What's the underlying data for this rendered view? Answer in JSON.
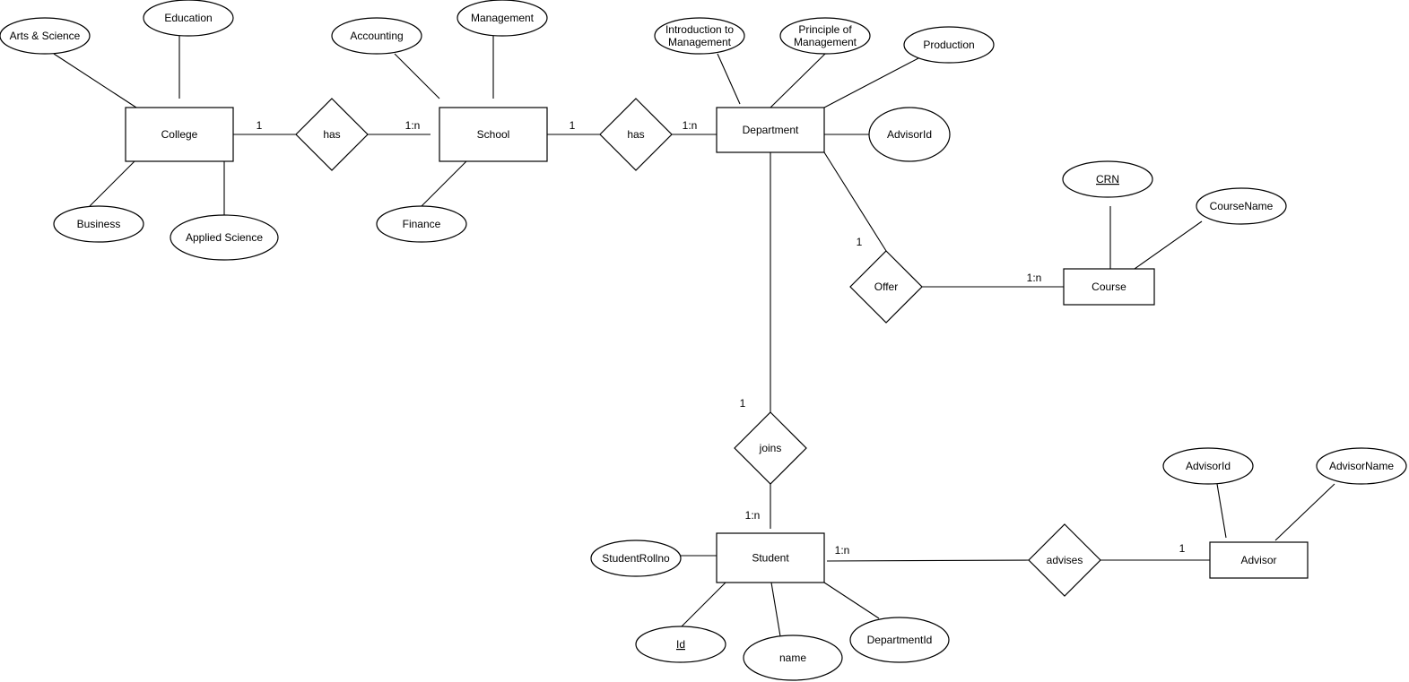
{
  "diagram": {
    "type": "entity-relationship",
    "entities": [
      {
        "id": "college",
        "label": "College"
      },
      {
        "id": "school",
        "label": "School"
      },
      {
        "id": "department",
        "label": "Department"
      },
      {
        "id": "course",
        "label": "Course"
      },
      {
        "id": "student",
        "label": "Student"
      },
      {
        "id": "advisor",
        "label": "Advisor"
      }
    ],
    "relationships": [
      {
        "id": "has1",
        "label": "has"
      },
      {
        "id": "has2",
        "label": "has"
      },
      {
        "id": "offer",
        "label": "Offer"
      },
      {
        "id": "joins",
        "label": "joins"
      },
      {
        "id": "advises",
        "label": "advises"
      }
    ],
    "attributes": [
      {
        "id": "a_arts",
        "label": "Arts & Science",
        "entity": "college"
      },
      {
        "id": "a_edu",
        "label": "Education",
        "entity": "college"
      },
      {
        "id": "a_bus",
        "label": "Business",
        "entity": "college"
      },
      {
        "id": "a_appsci",
        "label": "Applied Science",
        "entity": "college"
      },
      {
        "id": "a_acct",
        "label": "Accounting",
        "entity": "school"
      },
      {
        "id": "a_mgmt",
        "label": "Management",
        "entity": "school"
      },
      {
        "id": "a_fin",
        "label": "Finance",
        "entity": "school"
      },
      {
        "id": "a_intro",
        "label": [
          "Introduction to",
          "Management"
        ],
        "entity": "department"
      },
      {
        "id": "a_princ",
        "label": [
          "Principle of",
          "Management"
        ],
        "entity": "department"
      },
      {
        "id": "a_prod",
        "label": "Production",
        "entity": "department"
      },
      {
        "id": "a_advid_dept",
        "label": "AdvisorId",
        "entity": "department"
      },
      {
        "id": "a_crn",
        "label": "CRN",
        "entity": "course",
        "key": true
      },
      {
        "id": "a_cname",
        "label": "CourseName",
        "entity": "course"
      },
      {
        "id": "a_roll",
        "label": "StudentRollno",
        "entity": "student"
      },
      {
        "id": "a_id",
        "label": "Id",
        "entity": "student",
        "key": true
      },
      {
        "id": "a_name",
        "label": "name",
        "entity": "student"
      },
      {
        "id": "a_deptid",
        "label": "DepartmentId",
        "entity": "student"
      },
      {
        "id": "a_advid",
        "label": "AdvisorId",
        "entity": "advisor"
      },
      {
        "id": "a_advname",
        "label": "AdvisorName",
        "entity": "advisor"
      }
    ],
    "links": [
      {
        "from": "college",
        "to": "has1",
        "cardinality": "1"
      },
      {
        "from": "has1",
        "to": "school",
        "cardinality": "1:n"
      },
      {
        "from": "school",
        "to": "has2",
        "cardinality": "1"
      },
      {
        "from": "has2",
        "to": "department",
        "cardinality": "1:n"
      },
      {
        "from": "department",
        "to": "offer",
        "cardinality": "1"
      },
      {
        "from": "offer",
        "to": "course",
        "cardinality": "1:n"
      },
      {
        "from": "department",
        "to": "joins",
        "cardinality": "1"
      },
      {
        "from": "joins",
        "to": "student",
        "cardinality": "1:n"
      },
      {
        "from": "student",
        "to": "advises",
        "cardinality": "1:n"
      },
      {
        "from": "advises",
        "to": "advisor",
        "cardinality": "1"
      }
    ]
  }
}
